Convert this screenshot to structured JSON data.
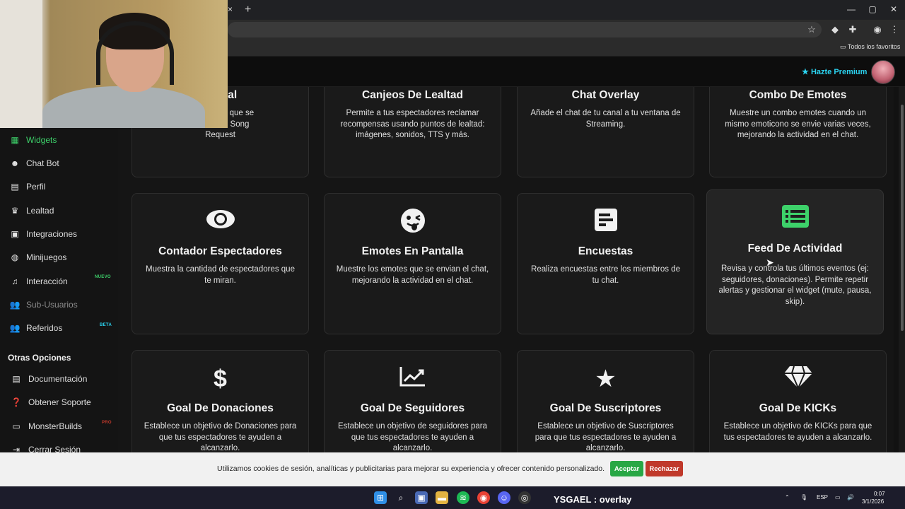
{
  "browser": {
    "tab_close": "×",
    "new_tab": "+",
    "win_min": "—",
    "win_max": "▢",
    "win_close": "✕",
    "bookmarks_all": "Todos los favoritos"
  },
  "header": {
    "premium_label": "Hazte Premium"
  },
  "sidebar": {
    "items": [
      {
        "label": "Widgets",
        "icon": "grid-icon"
      },
      {
        "label": "Chat Bot",
        "icon": "robot-icon"
      },
      {
        "label": "Perfil",
        "icon": "id-card-icon"
      },
      {
        "label": "Lealtad",
        "icon": "trophy-icon"
      },
      {
        "label": "Integraciones",
        "icon": "plug-icon"
      },
      {
        "label": "Minijuegos",
        "icon": "gamepad-icon"
      },
      {
        "label": "Interacción",
        "icon": "music-icon",
        "badge": "NUEVO"
      },
      {
        "label": "Sub-Usuarios",
        "icon": "users-icon"
      },
      {
        "label": "Referidos",
        "icon": "user-friends-icon",
        "badge": "BETA"
      }
    ],
    "other_title": "Otras Opciones",
    "other_items": [
      {
        "label": "Documentación",
        "icon": "book-icon"
      },
      {
        "label": "Obtener Soporte",
        "icon": "question-icon"
      },
      {
        "label": "MonsterBuilds",
        "icon": "laptop-icon",
        "badge": "PRO"
      },
      {
        "label": "Cerrar Sesión",
        "icon": "logout-icon"
      }
    ]
  },
  "cards": [
    {
      "title": "Actual",
      "desc": "l la canción que se\nla cola del Song\nRequest"
    },
    {
      "title": "Canjeos De Lealtad",
      "desc": "Permite a tus espectadores reclamar recompensas usando puntos de lealtad: imágenes, sonidos, TTS y más."
    },
    {
      "title": "Chat Overlay",
      "desc": "Añade el chat de tu canal a tu ventana de Streaming."
    },
    {
      "title": "Combo De Emotes",
      "desc": "Muestre un combo emotes cuando un mismo emoticono se envie varias veces, mejorando la actividad en el chat."
    },
    {
      "title": "Contador Espectadores",
      "desc": "Muestra la cantidad de espectadores que te miran.",
      "icon": "eye-icon"
    },
    {
      "title": "Emotes En Pantalla",
      "desc": "Muestre los emotes que se envian el chat, mejorando la actividad en el chat.",
      "icon": "tongue-emoji-icon"
    },
    {
      "title": "Encuestas",
      "desc": "Realiza encuestas entre los miembros de tu chat.",
      "icon": "poll-icon"
    },
    {
      "title": "Feed De Actividad",
      "desc": "Revisa y controla tus últimos eventos (ej: seguidores, donaciones). Permite repetir alertas y gestionar el widget (mute, pausa, skip).",
      "icon": "list-alt-icon"
    },
    {
      "title": "Goal De Donaciones",
      "desc": "Establece un objetivo de Donaciones para que tus espectadores te ayuden a alcanzarlo.",
      "icon": "dollar-icon"
    },
    {
      "title": "Goal De Seguidores",
      "desc": "Establece un objetivo de seguidores para que tus espectadores te ayuden a alcanzarlo.",
      "icon": "chart-line-icon"
    },
    {
      "title": "Goal De Suscriptores",
      "desc": "Establece un objetivo de Suscriptores para que tus espectadores te ayuden a alcanzarlo.",
      "icon": "star-icon"
    },
    {
      "title": "Goal De KICKs",
      "desc": "Establece un objetivo de KICKs para que tus espectadores te ayuden a alcanzarlo.",
      "icon": "gem-icon"
    }
  ],
  "cookie": {
    "text": "Utilizamos cookies de sesión, analíticas y publicitarias para mejorar su experiencia y ofrecer contenido personalizado.",
    "accept": "Aceptar",
    "reject": "Rechazar"
  },
  "taskbar": {
    "overlay_title": "YSGAEL : overlay",
    "lang": "ESP",
    "time": "0:07",
    "date": "3/1/2026"
  },
  "colors": {
    "accent_green": "#3dd16a",
    "premium_cyan": "#2bd3f0",
    "accept_green": "#28a745",
    "reject_red": "#c0392b"
  }
}
